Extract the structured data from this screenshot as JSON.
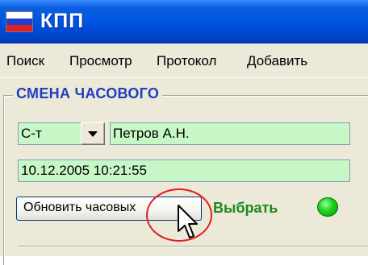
{
  "window": {
    "title": "КПП",
    "flag_icon": "russian-flag-icon"
  },
  "menu": {
    "items": [
      {
        "label": "Поиск"
      },
      {
        "label": "Просмотр"
      },
      {
        "label": "Протокол"
      },
      {
        "label": "Добавить"
      }
    ]
  },
  "group": {
    "title": "СМЕНА ЧАСОВОГО",
    "rank_value": "С-т",
    "name_value": "Петров А.Н.",
    "datetime_value": "10.12.2005 10:21:55",
    "refresh_button_label": "Обновить часовых",
    "select_label": "Выбрать",
    "status_led_color": "#1fd81f"
  },
  "colors": {
    "titlebar": "#0054e3",
    "field_bg": "#c7f7c7",
    "group_title": "#1f3fbe",
    "select_text": "#1c8a1c",
    "highlight": "#e02020"
  }
}
